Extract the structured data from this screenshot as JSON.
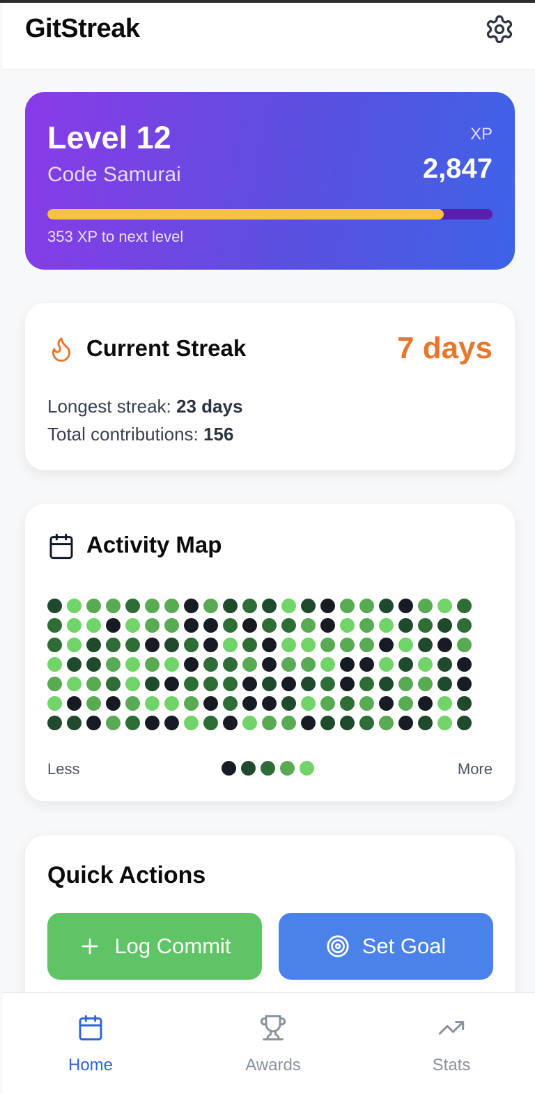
{
  "app": {
    "title": "GitStreak",
    "settings_icon": "gear-icon"
  },
  "level_card": {
    "level_label": "Level 12",
    "rank_title": "Code Samurai",
    "xp_label": "XP",
    "xp_value": "2,847",
    "progress_fraction": 0.89,
    "next_level_text": "353 XP to next level",
    "gradient_colors": [
      "#8a3be6",
      "#3d63e6"
    ],
    "progress_color": "#f5c33f",
    "track_color": "#5a1fae"
  },
  "streak": {
    "icon": "flame-icon",
    "title": "Current Streak",
    "value": "7 days",
    "value_color": "#e8772e",
    "longest_label": "Longest streak:",
    "longest_value": "23 days",
    "total_label": "Total contributions:",
    "total_value": "156"
  },
  "activity": {
    "icon": "calendar-icon",
    "title": "Activity Map",
    "levels_colors": [
      "#171b24",
      "#1f4a2c",
      "#2e6e36",
      "#58ab53",
      "#71d468"
    ],
    "grid": [
      [
        1,
        4,
        3,
        3,
        2,
        3,
        3,
        0,
        3,
        1,
        2,
        1,
        4,
        1,
        0,
        3,
        3,
        1,
        0,
        3,
        4,
        2
      ],
      [
        2,
        4,
        4,
        0,
        4,
        3,
        3,
        0,
        0,
        2,
        0,
        2,
        2,
        3,
        0,
        4,
        3,
        4,
        1,
        2,
        1,
        2
      ],
      [
        2,
        4,
        1,
        2,
        2,
        0,
        1,
        2,
        0,
        4,
        2,
        0,
        4,
        4,
        3,
        3,
        3,
        0,
        4,
        1,
        0,
        3
      ],
      [
        4,
        1,
        1,
        3,
        4,
        3,
        4,
        0,
        2,
        2,
        3,
        0,
        3,
        3,
        4,
        0,
        0,
        4,
        1,
        4,
        1,
        0
      ],
      [
        3,
        4,
        3,
        2,
        4,
        1,
        0,
        2,
        2,
        2,
        0,
        1,
        0,
        1,
        2,
        0,
        2,
        1,
        3,
        3,
        1,
        0
      ],
      [
        4,
        0,
        3,
        0,
        3,
        4,
        4,
        3,
        0,
        2,
        0,
        0,
        1,
        4,
        3,
        2,
        3,
        0,
        3,
        0,
        4,
        1
      ],
      [
        1,
        1,
        0,
        3,
        2,
        0,
        0,
        4,
        2,
        0,
        4,
        3,
        3,
        0,
        1,
        1,
        2,
        3,
        0,
        1,
        4,
        1
      ]
    ],
    "legend_less": "Less",
    "legend_more": "More"
  },
  "quick_actions": {
    "title": "Quick Actions",
    "log_commit": {
      "label": "Log Commit",
      "icon": "plus-icon",
      "color": "#5ec466"
    },
    "set_goal": {
      "label": "Set Goal",
      "icon": "target-icon",
      "color": "#4b82ea"
    }
  },
  "bottom_nav": {
    "items": [
      {
        "label": "Home",
        "icon": "calendar-icon",
        "active": true
      },
      {
        "label": "Awards",
        "icon": "trophy-icon",
        "active": false
      },
      {
        "label": "Stats",
        "icon": "trending-up-icon",
        "active": false
      }
    ],
    "active_color": "#2f64d8",
    "inactive_color": "#8a929d"
  }
}
